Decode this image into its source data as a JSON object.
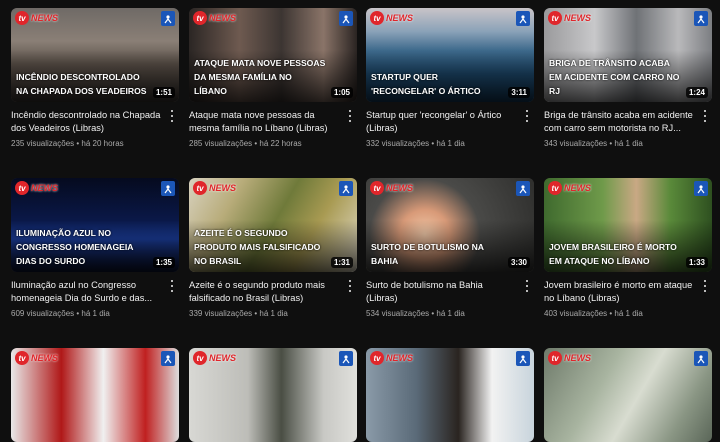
{
  "channel": {
    "logo_text": "NEWS",
    "logo_mark": "tv"
  },
  "colors": {
    "background": "#0f0f0f",
    "brand_red": "#e0262b",
    "badge_blue": "#1b56b8",
    "meta_gray": "#aaaaaa"
  },
  "videos": [
    {
      "overlay": "Incêndio descontrolado na Chapada dos Veadeiros",
      "duration": "1:51",
      "title": "Incêndio descontrolado na Chapada dos Veadeiros (Libras)",
      "views": "235 visualizações",
      "age": "há 20 horas"
    },
    {
      "overlay": "Ataque mata nove pessoas da mesma família no Líbano",
      "duration": "1:05",
      "title": "Ataque mata nove pessoas da mesma família no Líbano (Libras)",
      "views": "285 visualizações",
      "age": "há 22 horas"
    },
    {
      "overlay": "Startup quer 'recongelar' o Ártico",
      "duration": "3:11",
      "title": "Startup quer 'recongelar' o Ártico (Libras)",
      "views": "332 visualizações",
      "age": "há 1 dia"
    },
    {
      "overlay": "Briga de trânsito acaba em acidente com carro no RJ",
      "duration": "1:24",
      "title": "Briga de trânsito acaba em acidente com carro sem motorista no RJ...",
      "views": "343 visualizações",
      "age": "há 1 dia"
    },
    {
      "overlay": "Iluminação azul no Congresso homenageia Dias do Surdo",
      "duration": "1:35",
      "title": "Iluminação azul no Congresso homenageia Dia do Surdo e das...",
      "views": "609 visualizações",
      "age": "há 1 dia"
    },
    {
      "overlay": "Azeite é o segundo produto mais falsificado no Brasil",
      "duration": "1:31",
      "title": "Azeite é o segundo produto mais falsificado no Brasil (Libras)",
      "views": "339 visualizações",
      "age": "há 1 dia"
    },
    {
      "overlay": "Surto de botulismo na Bahia",
      "duration": "3:30",
      "title": "Surto de botulismo na Bahia (Libras)",
      "views": "534 visualizações",
      "age": "há 1 dia"
    },
    {
      "overlay": "Jovem brasileiro é morto em ataque no Líbano",
      "duration": "1:33",
      "title": "Jovem brasileiro é morto em ataque no Líbano (Libras)",
      "views": "403 visualizações",
      "age": "há 1 dia"
    },
    {
      "overlay": "",
      "duration": "",
      "title": "",
      "views": "",
      "age": ""
    },
    {
      "overlay": "",
      "duration": "",
      "title": "",
      "views": "",
      "age": ""
    },
    {
      "overlay": "",
      "duration": "",
      "title": "",
      "views": "",
      "age": ""
    },
    {
      "overlay": "",
      "duration": "",
      "title": "",
      "views": "",
      "age": ""
    }
  ]
}
